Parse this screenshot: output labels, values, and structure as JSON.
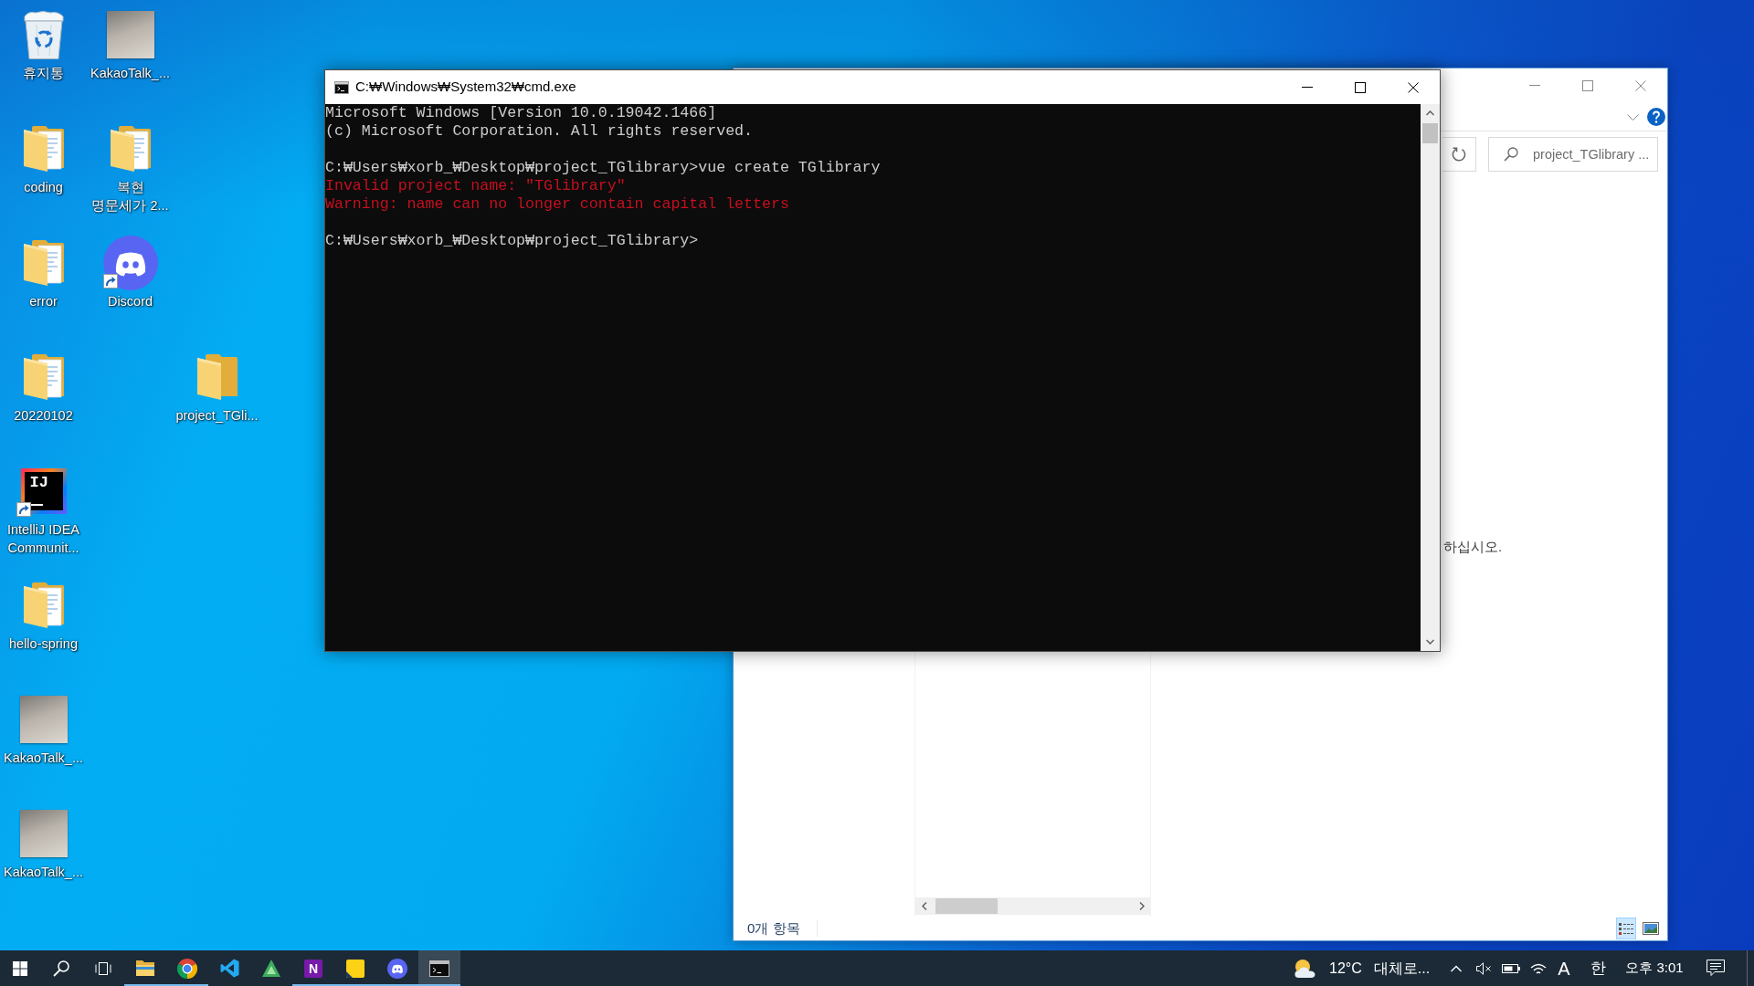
{
  "desktop": {
    "icons": [
      {
        "label": "휴지통",
        "kind": "bin",
        "shortcut": false
      },
      {
        "label": "KakaoTalk_...",
        "kind": "photo",
        "shortcut": false
      },
      {
        "label": "coding",
        "kind": "folder",
        "shortcut": false
      },
      {
        "label": "복현\n명문세가 2...",
        "kind": "folder",
        "shortcut": false
      },
      {
        "label": "error",
        "kind": "folder",
        "shortcut": false
      },
      {
        "label": "Discord",
        "kind": "chat",
        "shortcut": true
      },
      {
        "label": "20220102",
        "kind": "folder",
        "shortcut": false
      },
      {
        "label": "project_TGli...",
        "kind": "emptyfolder",
        "shortcut": false
      },
      {
        "label": "IntelliJ IDEA\nCommunit...",
        "kind": "ide",
        "logo_text": "IJ",
        "shortcut": true
      },
      {
        "label": "hello-spring",
        "kind": "folder",
        "shortcut": false
      },
      {
        "label": "KakaoTalk_...",
        "kind": "photo",
        "shortcut": false
      },
      {
        "label": "KakaoTalk_...",
        "kind": "photo",
        "shortcut": false
      }
    ]
  },
  "cmd_window": {
    "title": "C:₩Windows₩System32₩cmd.exe",
    "console": {
      "blocks": [
        [
          {
            "kind": "output",
            "text": "Microsoft Windows [Version 10.0.19042.1466]"
          },
          {
            "kind": "output",
            "text": "(c) Microsoft Corporation. All rights reserved."
          }
        ],
        [
          {
            "kind": "output",
            "text": "C:₩Users₩xorb_₩Desktop₩project_TGlibrary>vue create TGlibrary"
          },
          {
            "kind": "error",
            "text": "Invalid project name: \"TGlibrary\""
          },
          {
            "kind": "error",
            "text": "Warning: name can no longer contain capital letters"
          }
        ],
        [
          {
            "kind": "output",
            "text": "C:₩Users₩xorb_₩Desktop₩project_TGlibrary>"
          }
        ]
      ]
    }
  },
  "explorer_window": {
    "search": {
      "placeholder": "project_TGlibrary ..."
    },
    "preview_text": "하십시오.",
    "status_bar": {
      "item_count": "0개 항목"
    },
    "view_buttons": [
      {
        "kind": "details",
        "selected": true
      },
      {
        "kind": "largeicons",
        "selected": false
      }
    ]
  },
  "taskbar": {
    "apps": [
      {
        "kind": "files",
        "running": true,
        "selected": false
      },
      {
        "kind": "browser",
        "running": true,
        "selected": false
      },
      {
        "kind": "editor",
        "running": false,
        "selected": false
      },
      {
        "kind": "tree",
        "running": false,
        "selected": false
      },
      {
        "kind": "notes",
        "logo_text": "N",
        "running": true,
        "selected": false
      },
      {
        "kind": "sticky",
        "running": true,
        "selected": false
      },
      {
        "kind": "chat",
        "running": true,
        "selected": false
      },
      {
        "kind": "terminal",
        "running": true,
        "selected": true
      }
    ],
    "weather": {
      "temperature": "12°C",
      "condition": "대체로..."
    },
    "tray": {
      "input_mode": "A",
      "ime": "한",
      "clock": "오후 3:01"
    }
  }
}
